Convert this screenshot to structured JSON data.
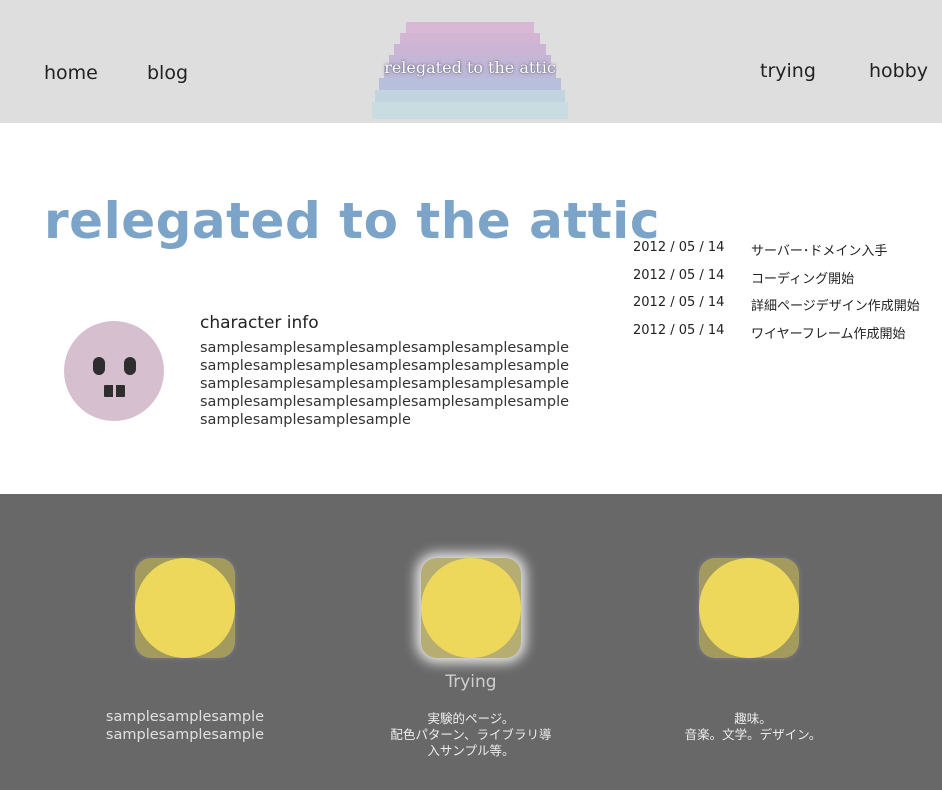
{
  "header": {
    "nav": {
      "home": "home",
      "blog": "blog",
      "trying": "trying",
      "hobby": "hobby"
    },
    "logo_text": "relegated to the attic",
    "stair_colors": [
      "#d8b8d4",
      "#d2b5d3",
      "#ccb5d4",
      "#c4b6d6",
      "#bcb9d8",
      "#b7bfdc",
      "#c2d5df",
      "#c9dce2"
    ]
  },
  "main": {
    "title": "relegated to the attic",
    "character": {
      "title": "character info",
      "text": "samplesamplesamplesamplesamplesamplesamplesamplesamplesamplesamplesamplesamplesamplesamplesamplesamplesamplesamplesamplesamplesamplesamplesamplesamplesamplesamplesamplesamplesamplesamplesample"
    },
    "news": [
      {
        "date": "2012 / 05 / 14",
        "title": "サーバー･ドメイン入手"
      },
      {
        "date": "2012 / 05 / 14",
        "title": "コーディング開始"
      },
      {
        "date": "2012 / 05 / 14",
        "title": "詳細ページデザイン作成開始"
      },
      {
        "date": "2012 / 05 / 14",
        "title": "ワイヤーフレーム作成開始"
      }
    ]
  },
  "footer": {
    "cards": [
      {
        "title": "",
        "lines": [
          "samplesamplesample",
          "samplesamplesample"
        ]
      },
      {
        "title": "Trying",
        "lines": [
          "実験的ページ。",
          "配色パターン、ライブラリ導",
          "入サンプル等。"
        ]
      },
      {
        "title": "",
        "lines": [
          "趣味。",
          "音楽。文学。デザイン。"
        ]
      }
    ],
    "colors": {
      "background": "#686868",
      "circle": "#eed85c",
      "square": "#a39a5e"
    }
  },
  "colors": {
    "header_bg": "#dedede",
    "title": "#7ca4c8",
    "avatar": "#d6bfcf"
  }
}
